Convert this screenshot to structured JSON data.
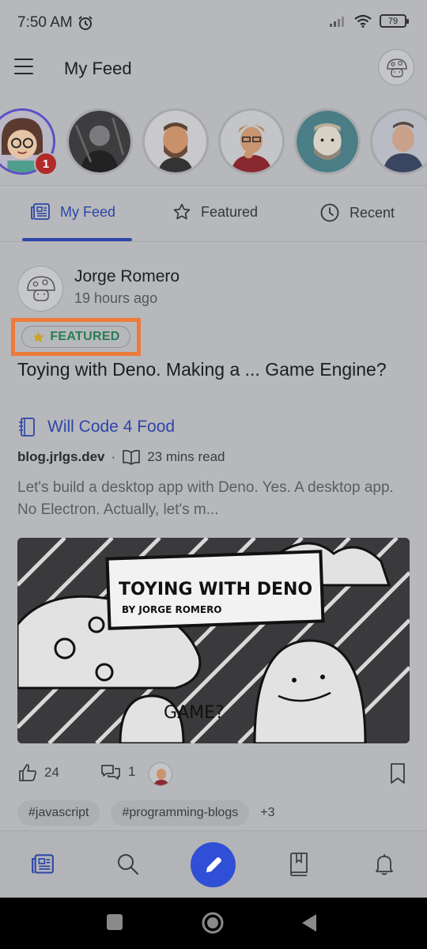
{
  "status_bar": {
    "time": "7:50 AM",
    "battery": "79"
  },
  "header": {
    "title": "My Feed"
  },
  "stories": [
    {
      "name": "story-1",
      "badge": "1"
    },
    {
      "name": "story-2"
    },
    {
      "name": "story-3"
    },
    {
      "name": "story-4"
    },
    {
      "name": "story-5"
    },
    {
      "name": "story-6"
    }
  ],
  "tabs": [
    {
      "label": "My Feed",
      "icon": "newspaper-icon",
      "active": true
    },
    {
      "label": "Featured",
      "icon": "star-icon"
    },
    {
      "label": "Recent",
      "icon": "clock-icon"
    }
  ],
  "post": {
    "author": "Jorge Romero",
    "time": "19 hours ago",
    "featured_label": "FEATURED",
    "title": "Toying with Deno. Making a ... Game Engine?",
    "blog_name": "Will Code 4 Food",
    "domain": "blog.jrlgs.dev",
    "separator": "·",
    "read_time": "23 mins read",
    "excerpt": "Let's build a desktop app with Deno. Yes. A desktop app. No Electron. Actually, let's m...",
    "cover": {
      "title": "TOYING WITH DENO",
      "byline": "BY JORGE ROMERO",
      "caption": "GAME?"
    },
    "likes": "24",
    "comments": "1",
    "tags": [
      "#javascript",
      "#programming-blogs"
    ],
    "more_tags": "+3"
  },
  "bottom_nav": [
    "feed-icon",
    "search-icon",
    "pencil-icon",
    "bookmarks-icon",
    "bell-icon"
  ],
  "colors": {
    "accent": "#2d46a8",
    "featured_green": "#2a7c58",
    "highlight_orange": "#ee7a3a",
    "badge_red": "#b22a2a"
  }
}
